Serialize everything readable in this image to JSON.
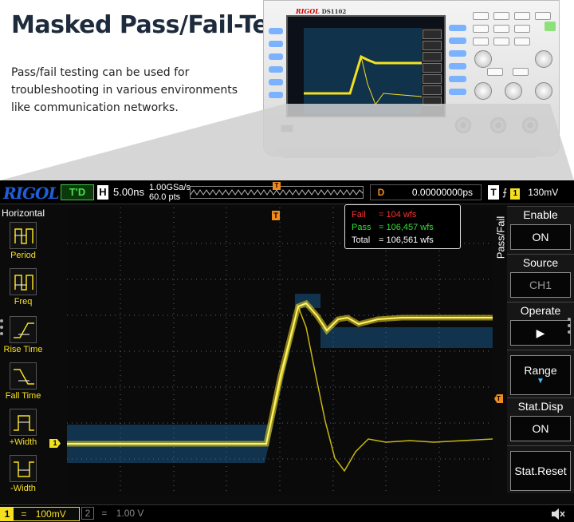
{
  "page": {
    "headline": "Masked Pass/Fail-Tests",
    "description": "Pass/fail testing can be used for troubleshooting in various environments like communication networks."
  },
  "device_photo": {
    "brand": "RIGOL",
    "model": "DS1102"
  },
  "scope": {
    "brand": "RIGOL",
    "trigger_status": "T'D",
    "timebase_label": "H",
    "timebase": "5.00ns",
    "sample_rate": "1.00GSa/s",
    "memory_depth": "60.0 pts",
    "delay_label": "D",
    "delay_value": "0.00000000ps",
    "trigger_label": "T",
    "trigger_edge": "⨍",
    "trigger_channel": "1",
    "trigger_level": "130mV",
    "trigger_marker": "T",
    "ch1_marker": "1",
    "trigger_level_marker": "T",
    "left_menu": {
      "title": "Horizontal",
      "items": [
        {
          "label": "Period",
          "icon": "period-icon"
        },
        {
          "label": "Freq",
          "icon": "freq-icon"
        },
        {
          "label": "Rise Time",
          "icon": "rise-time-icon"
        },
        {
          "label": "Fall Time",
          "icon": "fall-time-icon"
        },
        {
          "label": "+Width",
          "icon": "positive-width-icon"
        },
        {
          "label": "-Width",
          "icon": "negative-width-icon"
        }
      ]
    },
    "stats": {
      "fail_label": "Fail",
      "fail_value": "= 104 wfs",
      "pass_label": "Pass",
      "pass_value": "= 106,457 wfs",
      "total_label": "Total",
      "total_value": "= 106,561 wfs"
    },
    "right_menu": {
      "title": "Pass/Fail",
      "enable": {
        "label": "Enable",
        "value": "ON"
      },
      "source": {
        "label": "Source",
        "value": "CH1"
      },
      "operate": {
        "label": "Operate",
        "value": "▶"
      },
      "range": {
        "label": "Range",
        "arrow": "▼"
      },
      "stat_disp": {
        "label": "Stat.Disp",
        "value": "ON"
      },
      "stat_reset": {
        "label": "Stat.Reset"
      }
    },
    "channels": [
      {
        "number": "1",
        "coupling": "=",
        "scale": "100mV"
      },
      {
        "number": "2",
        "coupling": "=",
        "scale": "1.00 V"
      }
    ],
    "colors": {
      "ch1": "#f5e020",
      "trigger": "#f08a1a",
      "plot_bg": "#12334d",
      "fail": "#ff3030",
      "pass": "#30e030",
      "brand": "#1f5fd8"
    }
  }
}
